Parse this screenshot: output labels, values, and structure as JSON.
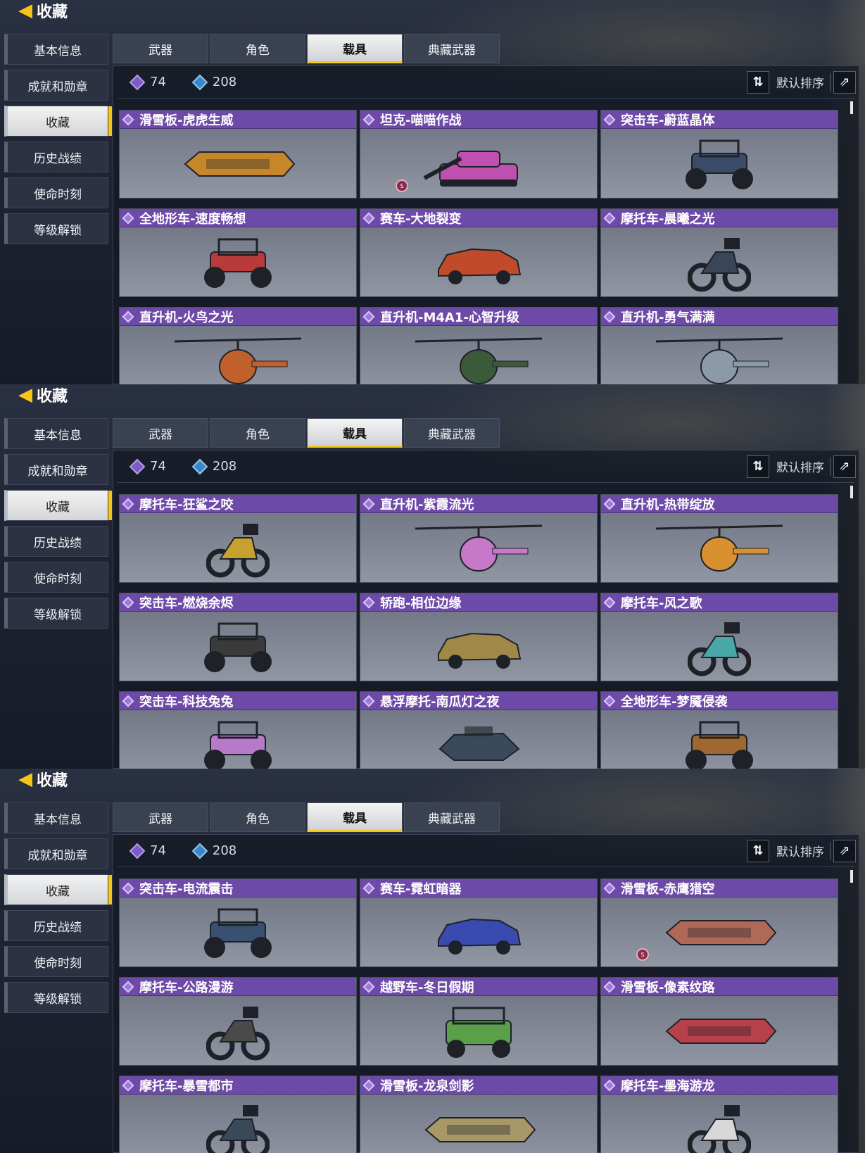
{
  "panels": [
    {
      "header": {
        "title": "收藏"
      },
      "sidebar": [
        "基本信息",
        "成就和勋章",
        "收藏",
        "历史战绩",
        "使命时刻",
        "等级解锁"
      ],
      "tabs": [
        "武器",
        "角色",
        "载具",
        "典藏武器"
      ],
      "stats": {
        "purple": "74",
        "blue": "208"
      },
      "sort_label": "默认排序",
      "cards": [
        {
          "name": "滑雪板-虎虎生威",
          "color": "#c8862a",
          "shape": "board"
        },
        {
          "name": "坦克-喵喵作战",
          "color": "#c050b0",
          "shape": "tank",
          "badge": "S"
        },
        {
          "name": "突击车-蔚蓝晶体",
          "color": "#3a4a68",
          "shape": "buggy"
        },
        {
          "name": "全地形车-速度畅想",
          "color": "#b83a3a",
          "shape": "atv"
        },
        {
          "name": "赛车-大地裂变",
          "color": "#c04a2a",
          "shape": "car"
        },
        {
          "name": "摩托车-晨曦之光",
          "color": "#3a4658",
          "shape": "moto"
        },
        {
          "name": "直升机-火鸟之光",
          "color": "#c0602a",
          "shape": "heli"
        },
        {
          "name": "直升机-M4A1-心智升级",
          "color": "#3a5a3a",
          "shape": "heli"
        },
        {
          "name": "直升机-勇气满满",
          "color": "#8a9aa8",
          "shape": "heli"
        }
      ]
    },
    {
      "header": {
        "title": "收藏"
      },
      "sidebar": [
        "基本信息",
        "成就和勋章",
        "收藏",
        "历史战绩",
        "使命时刻",
        "等级解锁"
      ],
      "tabs": [
        "武器",
        "角色",
        "载具",
        "典藏武器"
      ],
      "stats": {
        "purple": "74",
        "blue": "208"
      },
      "sort_label": "默认排序",
      "cards": [
        {
          "name": "摩托车-狂鲨之咬",
          "color": "#c8a030",
          "shape": "moto"
        },
        {
          "name": "直升机-紫霞流光",
          "color": "#c878c8",
          "shape": "heli"
        },
        {
          "name": "直升机-热带绽放",
          "color": "#d89030",
          "shape": "heli"
        },
        {
          "name": "突击车-燃烧余烬",
          "color": "#3a3a3a",
          "shape": "buggy"
        },
        {
          "name": "轿跑-相位边缘",
          "color": "#a08848",
          "shape": "car"
        },
        {
          "name": "摩托车-风之歌",
          "color": "#48a8a8",
          "shape": "moto"
        },
        {
          "name": "突击车-科技兔兔",
          "color": "#b87ac8",
          "shape": "buggy"
        },
        {
          "name": "悬浮摩托-南瓜灯之夜",
          "color": "#3a4a5a",
          "shape": "hover"
        },
        {
          "name": "全地形车-梦魇侵袭",
          "color": "#a06830",
          "shape": "atv"
        }
      ]
    },
    {
      "header": {
        "title": "收藏"
      },
      "sidebar": [
        "基本信息",
        "成就和勋章",
        "收藏",
        "历史战绩",
        "使命时刻",
        "等级解锁"
      ],
      "tabs": [
        "武器",
        "角色",
        "载具",
        "典藏武器"
      ],
      "stats": {
        "purple": "74",
        "blue": "208"
      },
      "sort_label": "默认排序",
      "cards": [
        {
          "name": "突击车-电流震击",
          "color": "#3a5070",
          "shape": "buggy"
        },
        {
          "name": "赛车-霓虹暗器",
          "color": "#3a4ab0",
          "shape": "car"
        },
        {
          "name": "滑雪板-赤鹰猎空",
          "color": "#b06858",
          "shape": "board",
          "badge": "S"
        },
        {
          "name": "摩托车-公路漫游",
          "color": "#4a4a4a",
          "shape": "moto"
        },
        {
          "name": "越野车-冬日假期",
          "color": "#5aa048",
          "shape": "jeep"
        },
        {
          "name": "滑雪板-像素纹路",
          "color": "#b8404a",
          "shape": "board"
        },
        {
          "name": "摩托车-暴雪都市",
          "color": "#3a4a58",
          "shape": "moto"
        },
        {
          "name": "滑雪板-龙泉剑影",
          "color": "#a89868",
          "shape": "board"
        },
        {
          "name": "摩托车-墨海游龙",
          "color": "#d8d8d8",
          "shape": "moto"
        }
      ]
    }
  ]
}
